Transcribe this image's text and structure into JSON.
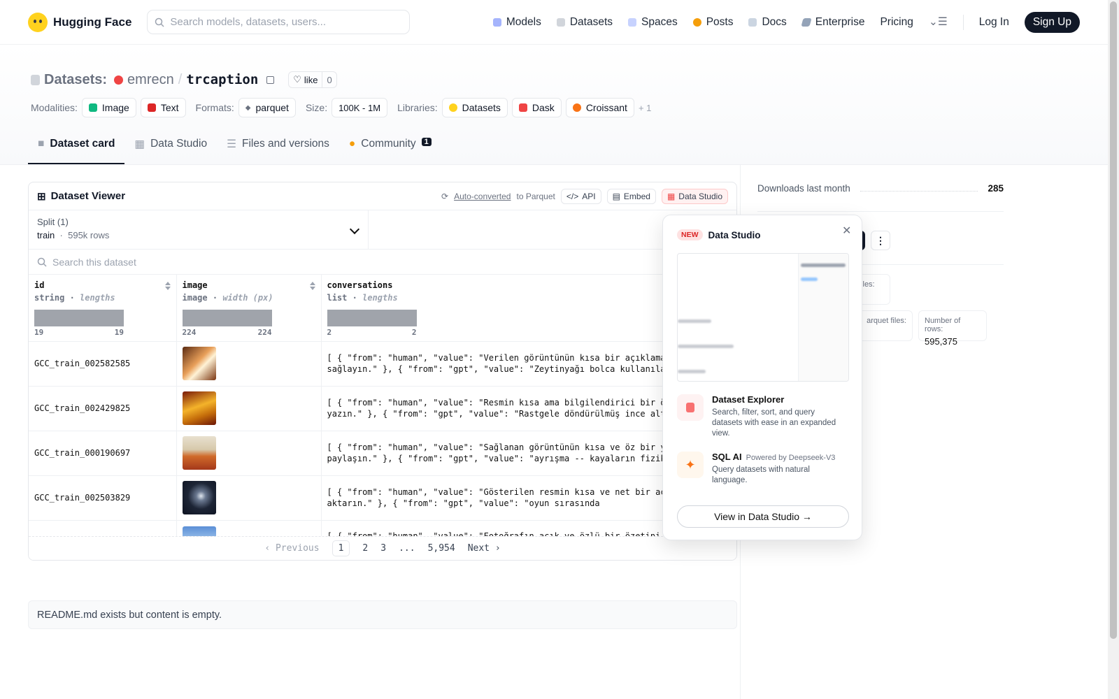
{
  "nav": {
    "brand": "Hugging Face",
    "search_placeholder": "Search models, datasets, users...",
    "links": [
      "Models",
      "Datasets",
      "Spaces",
      "Posts",
      "Docs",
      "Enterprise",
      "Pricing"
    ],
    "login": "Log In",
    "signup": "Sign Up"
  },
  "header": {
    "section": "Datasets:",
    "owner": "emrecn",
    "slash": "/",
    "name": "trcaption",
    "like_label": "like",
    "like_count": "0",
    "tags": {
      "modalities_label": "Modalities:",
      "modalities": [
        "Image",
        "Text"
      ],
      "formats_label": "Formats:",
      "format": "parquet",
      "size_label": "Size:",
      "size": "100K - 1M",
      "libraries_label": "Libraries:",
      "libraries": [
        "Datasets",
        "Dask",
        "Croissant"
      ],
      "more": "+ 1"
    }
  },
  "tabs": [
    "Dataset card",
    "Data Studio",
    "Files and versions",
    "Community"
  ],
  "community_count": "1",
  "viewer": {
    "title": "Dataset Viewer",
    "auto_converted": "Auto-converted",
    "to_parquet": "to Parquet",
    "api": "API",
    "embed": "Embed",
    "data_studio": "Data Studio",
    "split_label": "Split (1)",
    "split_name": "train",
    "split_rows": "595k rows",
    "search_placeholder": "Search this dataset",
    "columns": [
      {
        "name": "id",
        "type": "string",
        "stat": "lengths",
        "min": "19",
        "max": "19"
      },
      {
        "name": "image",
        "type": "image",
        "stat": "width (px)",
        "min": "224",
        "max": "224"
      },
      {
        "name": "conversations",
        "type": "list",
        "stat": "lengths",
        "min": "2",
        "max": "2"
      }
    ],
    "rows": [
      {
        "id": "GCC_train_002582585",
        "conv": "[ { \"from\": \"human\", \"value\": \"Verilen görüntünün kısa bir açıklamasını sağlayın.\" }, { \"from\": \"gpt\", \"value\": \"Zeytinyağı bolca kullanılan"
      },
      {
        "id": "GCC_train_002429825",
        "conv": "[ { \"from\": \"human\", \"value\": \"Resmin kısa ama bilgilendirici bir özetini yazın.\" }, { \"from\": \"gpt\", \"value\": \"Rastgele döndürülmüş ince altın"
      },
      {
        "id": "GCC_train_000190697",
        "conv": "[ { \"from\": \"human\", \"value\": \"Sağlanan görüntünün kısa ve öz bir yorumunu paylaşın.\" }, { \"from\": \"gpt\", \"value\": \"ayrışma -- kayaların fiziksel"
      },
      {
        "id": "GCC_train_002503829",
        "conv": "[ { \"from\": \"human\", \"value\": \"Gösterilen resmin kısa ve net bir açıklamasını aktarın.\" }, { \"from\": \"gpt\", \"value\": \"oyun sırasında"
      },
      {
        "id": "",
        "conv": "[ { \"from\": \"human\", \"value\": \"Fotoğrafın açık ve özlü bir özetini"
      }
    ],
    "pager": {
      "prev": "Previous",
      "pages": [
        "1",
        "2",
        "3",
        "...",
        "5,954"
      ],
      "next": "Next"
    }
  },
  "readme": "README.md exists but content is empty.",
  "right": {
    "downloads_label": "Downloads last month",
    "downloads_value": "285",
    "stat1_label": "files:",
    "stat2_label": "arquet files:",
    "stat3_label": "Number of rows:",
    "stat3_value": "595,375"
  },
  "popover": {
    "new_tag": "NEW",
    "title": "Data Studio",
    "explorer_title": "Dataset Explorer",
    "explorer_desc": "Search, filter, sort, and query datasets with ease in an expanded view.",
    "sql_title": "SQL AI",
    "sql_powered": "Powered by Deepseek-V3",
    "sql_desc": "Query datasets with natural language.",
    "cta": "View in Data Studio →"
  }
}
